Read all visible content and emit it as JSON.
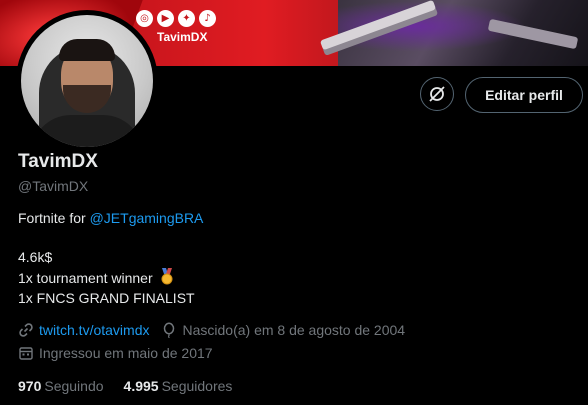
{
  "banner": {
    "handle_tag": "TavimDX",
    "social_icons": [
      "instagram-icon",
      "youtube-icon",
      "twitter-icon",
      "tiktok-icon"
    ]
  },
  "actions": {
    "edit_profile_label": "Editar perfil"
  },
  "profile": {
    "display_name": "TavimDX",
    "username": "@TavimDX"
  },
  "bio": {
    "line1_prefix": "Fortnite for ",
    "line1_mention": "@JETgamingBRA",
    "line2": "4.6k$",
    "line3": "1x tournament winner",
    "line4": "1x FNCS GRAND FINALIST"
  },
  "meta": {
    "website": "twitch.tv/otavimdx",
    "birth": "Nascido(a) em 8 de agosto de 2004",
    "joined": "Ingressou em maio de 2017"
  },
  "stats": {
    "following_count": "970",
    "following_label": "Seguindo",
    "followers_count": "4.995",
    "followers_label": "Seguidores"
  },
  "colors": {
    "background": "#000000",
    "text_primary": "#e7e9ea",
    "text_secondary": "#71767b",
    "link": "#1d9bf0",
    "button_border": "#536471",
    "banner_red": "#e01c22"
  }
}
